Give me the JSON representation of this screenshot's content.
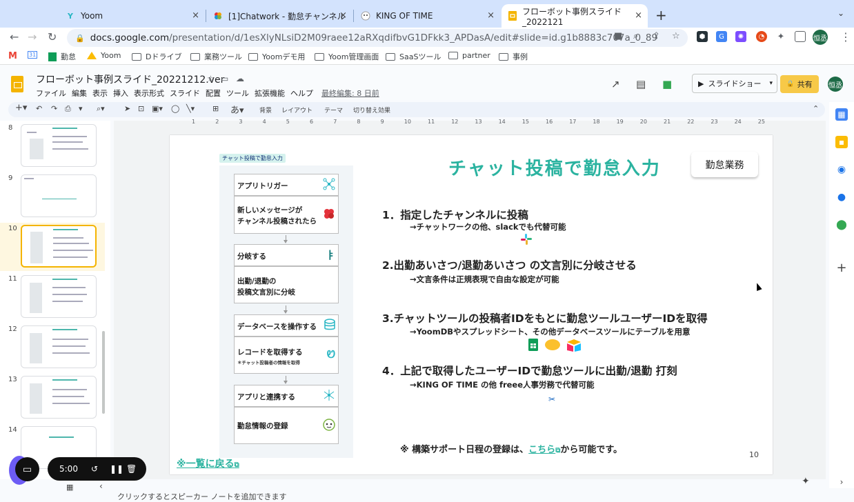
{
  "browser": {
    "tabs": [
      {
        "title": "Yoom",
        "icon": "yoom-icon",
        "active": false
      },
      {
        "title": "[1]Chatwork - 勤怠チャンネル",
        "icon": "chatwork-icon",
        "active": false
      },
      {
        "title": "KING OF TIME",
        "icon": "kingoftime-icon",
        "active": false
      },
      {
        "title": "フローボット事例スライド_2022121",
        "icon": "slides-icon",
        "active": true
      }
    ],
    "tab_close": "×",
    "new_tab": "+",
    "tab_menu": "⌄",
    "url_host": "docs.google.com",
    "url_path": "/presentation/d/1esXlyNLsiD2M09raee12aRXqdifbvG1DFkk3_APDasA/edit#slide=id.g1b8883c707a_0_89",
    "bookmarks": [
      "勤怠",
      "Yoom",
      "Dドライブ",
      "業務ツール",
      "Yoomデモ用",
      "Yoom管理画面",
      "SaaSツール",
      "partner",
      "事例"
    ],
    "gmail_label": "M",
    "calendar_label": "31",
    "profile_initials": "恒丞"
  },
  "slides_app": {
    "doc_title": "フローボット事例スライド_20221212.ver",
    "menus": [
      "ファイル",
      "編集",
      "表示",
      "挿入",
      "表示形式",
      "スライド",
      "配置",
      "ツール",
      "拡張機能",
      "ヘルプ"
    ],
    "last_edit": "最終編集: 8 日前",
    "slideshow_label": "スライドショー",
    "share_label": "共有",
    "profile_initials": "恒丞",
    "toolbar": {
      "bg": "背景",
      "layout": "レイアウト",
      "theme": "テーマ",
      "transition": "切り替え効果"
    },
    "speaker_notes_placeholder": "クリックするとスピーカー ノートを追加できます"
  },
  "filmstrip": {
    "slides": [
      {
        "num": "8",
        "selected": false
      },
      {
        "num": "9",
        "selected": false
      },
      {
        "num": "10",
        "selected": true
      },
      {
        "num": "11",
        "selected": false
      },
      {
        "num": "12",
        "selected": false
      },
      {
        "num": "13",
        "selected": false
      },
      {
        "num": "14",
        "selected": false
      }
    ]
  },
  "ruler": [
    "1",
    "2",
    "3",
    "4",
    "5",
    "6",
    "7",
    "8",
    "9",
    "10",
    "11",
    "12",
    "13",
    "14",
    "15",
    "16",
    "17",
    "18",
    "19",
    "20",
    "21",
    "22",
    "23",
    "24",
    "25"
  ],
  "slide": {
    "tag": "チャット投稿で勤怠入力",
    "title": "チャット投稿で勤怠入力",
    "badge": "勤怠業務",
    "flow": {
      "b1_head": "アプリトリガー",
      "b1_body_1": "新しいメッセージが",
      "b1_body_2": "チャンネル投稿されたら",
      "b2_head": "分岐する",
      "b2_body_1": "出勤/退勤の",
      "b2_body_2": "投稿文言別に分岐",
      "b3_head": "データベースを操作する",
      "b3_body": "レコードを取得する",
      "b3_sub": "＊チャット投稿者の情報を取得",
      "b4_head": "アプリと連携する",
      "b4_body": "勤怠情報の登録"
    },
    "points": [
      {
        "title": "1．指定したチャンネルに投稿",
        "sub": "→チャットワークの他、slackでも代替可能"
      },
      {
        "title": "2.出勤あいさつ/退勤あいさつ の文言別に分岐させる",
        "sub": "→文言条件は正規表現で自由な設定が可能"
      },
      {
        "title": "3.チャットツールの投稿者IDをもとに勤怠ツールユーザーIDを取得",
        "sub": "→YoomDBやスプレッドシート、その他データベースツールにテーブルを用意"
      },
      {
        "title": "4．上記で取得したユーザーIDで勤怠ツールに出勤/退勤 打刻",
        "sub": "→KING OF TIME の他 freee人事労務で代替可能"
      }
    ],
    "note_prefix": "※ 構築サポート日程の登録は、",
    "note_link": "こちら",
    "note_suffix": "から可能です。",
    "back_link": "※一覧に戻る",
    "page_number": "10"
  },
  "recorder": {
    "time": "5:00"
  },
  "colors": {
    "accent": "#2bb3a0",
    "share": "#f7c948",
    "thumb_selected": "#f4b400"
  }
}
